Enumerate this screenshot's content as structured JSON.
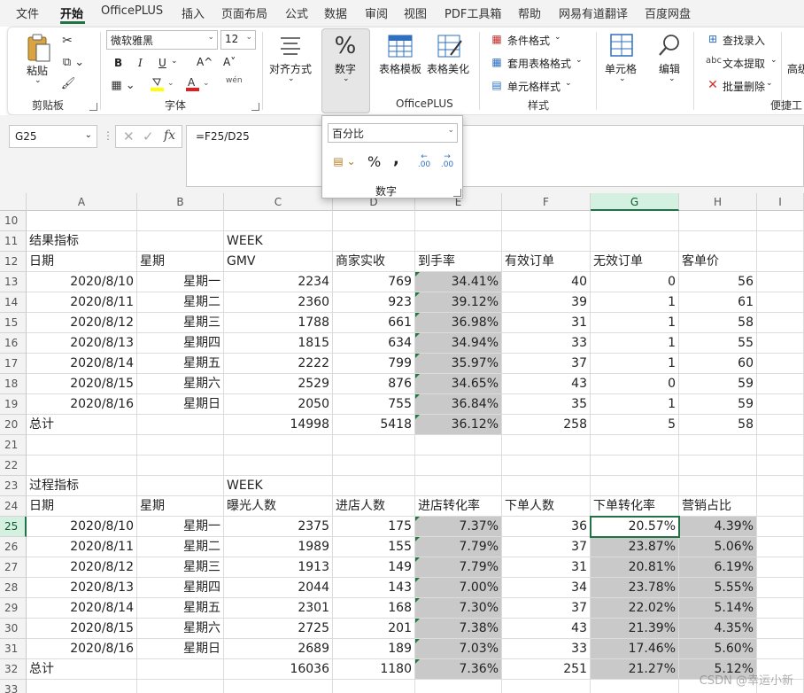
{
  "menu": [
    "文件",
    "开始",
    "OfficePLUS",
    "插入",
    "页面布局",
    "公式",
    "数据",
    "审阅",
    "视图",
    "PDF工具箱",
    "帮助",
    "网易有道翻译",
    "百度网盘"
  ],
  "ribbon": {
    "clipboard": {
      "paste": "粘贴",
      "group": "剪贴板"
    },
    "font": {
      "name": "微软雅黑",
      "size": "12",
      "bold": "B",
      "italic": "I",
      "underline": "U",
      "grow": "A^",
      "shrink": "A˅",
      "phonetic": "wén",
      "group": "字体"
    },
    "align": {
      "label": "对齐方式"
    },
    "number": {
      "label": "数字"
    },
    "officeplus": {
      "table_template": "表格模板",
      "table_beautify": "表格美化",
      "group": "OfficePLUS"
    },
    "styles": {
      "conditional": "条件格式",
      "table_format": "套用表格格式",
      "cell_style": "单元格样式",
      "group": "样式"
    },
    "cells": {
      "label": "单元格"
    },
    "edit": {
      "label": "编辑"
    },
    "quick": {
      "find": "查找录入",
      "extract": "文本提取",
      "batch_delete": "批量删除",
      "group": "便捷工",
      "high": "高级"
    }
  },
  "formula_bar": {
    "name_box": "G25",
    "formula": "=F25/D25"
  },
  "number_popup": {
    "format": "百分比",
    "percent": "%",
    "comma": ",",
    "increase_decimal": ".00",
    "decrease_decimal": ".00",
    "group": "数字"
  },
  "columns": [
    "A",
    "B",
    "C",
    "D",
    "E",
    "F",
    "G",
    "H",
    "I"
  ],
  "rows": [
    {
      "n": "10",
      "c": [
        "",
        "",
        "",
        "",
        "",
        "",
        "",
        "",
        ""
      ]
    },
    {
      "n": "11",
      "c": [
        "结果指标",
        "",
        "WEEK",
        "",
        "",
        "",
        "",
        "",
        ""
      ]
    },
    {
      "n": "12",
      "c": [
        "日期",
        "星期",
        "GMV",
        "商家实收",
        "到手率",
        "有效订单",
        "无效订单",
        "客单价",
        ""
      ]
    },
    {
      "n": "13",
      "c": [
        "2020/8/10",
        "星期一",
        "2234",
        "769",
        "34.41%",
        "40",
        "0",
        "56",
        ""
      ]
    },
    {
      "n": "14",
      "c": [
        "2020/8/11",
        "星期二",
        "2360",
        "923",
        "39.12%",
        "39",
        "1",
        "61",
        ""
      ]
    },
    {
      "n": "15",
      "c": [
        "2020/8/12",
        "星期三",
        "1788",
        "661",
        "36.98%",
        "31",
        "1",
        "58",
        ""
      ]
    },
    {
      "n": "16",
      "c": [
        "2020/8/13",
        "星期四",
        "1815",
        "634",
        "34.94%",
        "33",
        "1",
        "55",
        ""
      ]
    },
    {
      "n": "17",
      "c": [
        "2020/8/14",
        "星期五",
        "2222",
        "799",
        "35.97%",
        "37",
        "1",
        "60",
        ""
      ]
    },
    {
      "n": "18",
      "c": [
        "2020/8/15",
        "星期六",
        "2529",
        "876",
        "34.65%",
        "43",
        "0",
        "59",
        ""
      ]
    },
    {
      "n": "19",
      "c": [
        "2020/8/16",
        "星期日",
        "2050",
        "755",
        "36.84%",
        "35",
        "1",
        "59",
        ""
      ]
    },
    {
      "n": "20",
      "c": [
        "总计",
        "",
        "14998",
        "5418",
        "36.12%",
        "258",
        "5",
        "58",
        ""
      ]
    },
    {
      "n": "21",
      "c": [
        "",
        "",
        "",
        "",
        "",
        "",
        "",
        "",
        ""
      ]
    },
    {
      "n": "22",
      "c": [
        "",
        "",
        "",
        "",
        "",
        "",
        "",
        "",
        ""
      ]
    },
    {
      "n": "23",
      "c": [
        "过程指标",
        "",
        "WEEK",
        "",
        "",
        "",
        "",
        "",
        ""
      ]
    },
    {
      "n": "24",
      "c": [
        "日期",
        "星期",
        "曝光人数",
        "进店人数",
        "进店转化率",
        "下单人数",
        "下单转化率",
        "营销占比",
        ""
      ]
    },
    {
      "n": "25",
      "c": [
        "2020/8/10",
        "星期一",
        "2375",
        "175",
        "7.37%",
        "36",
        "20.57%",
        "4.39%",
        ""
      ]
    },
    {
      "n": "26",
      "c": [
        "2020/8/11",
        "星期二",
        "1989",
        "155",
        "7.79%",
        "37",
        "23.87%",
        "5.06%",
        ""
      ]
    },
    {
      "n": "27",
      "c": [
        "2020/8/12",
        "星期三",
        "1913",
        "149",
        "7.79%",
        "31",
        "20.81%",
        "6.19%",
        ""
      ]
    },
    {
      "n": "28",
      "c": [
        "2020/8/13",
        "星期四",
        "2044",
        "143",
        "7.00%",
        "34",
        "23.78%",
        "5.55%",
        ""
      ]
    },
    {
      "n": "29",
      "c": [
        "2020/8/14",
        "星期五",
        "2301",
        "168",
        "7.30%",
        "37",
        "22.02%",
        "5.14%",
        ""
      ]
    },
    {
      "n": "30",
      "c": [
        "2020/8/15",
        "星期六",
        "2725",
        "201",
        "7.38%",
        "43",
        "21.39%",
        "4.35%",
        ""
      ]
    },
    {
      "n": "31",
      "c": [
        "2020/8/16",
        "星期日",
        "2689",
        "189",
        "7.03%",
        "33",
        "17.46%",
        "5.60%",
        ""
      ]
    },
    {
      "n": "32",
      "c": [
        "总计",
        "",
        "16036",
        "1180",
        "7.36%",
        "251",
        "21.27%",
        "5.12%",
        ""
      ]
    },
    {
      "n": "33",
      "c": [
        "",
        "",
        "",
        "",
        "",
        "",
        "",
        "",
        ""
      ]
    }
  ],
  "watermark": "CSDN @幸运小新"
}
